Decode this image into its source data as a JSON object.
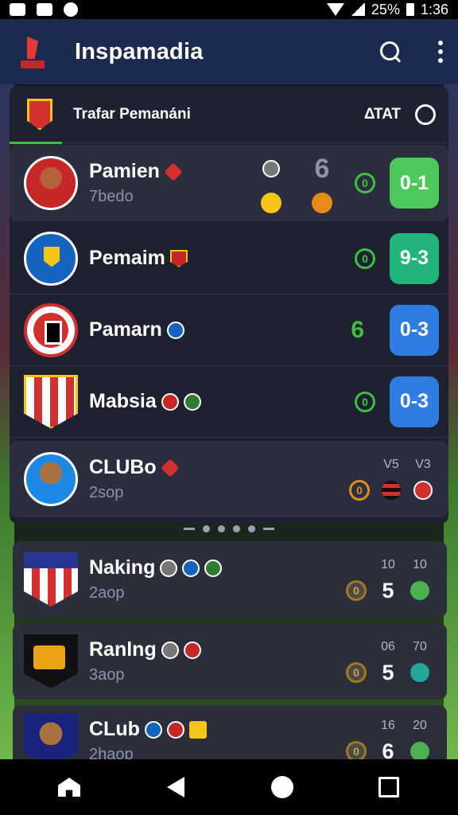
{
  "status_bar": {
    "battery": "25%",
    "time": "1:36"
  },
  "app_bar": {
    "title": "Inspamadia"
  },
  "filter": {
    "label": "Trafar Pemanáni",
    "date": "ΔΤΑΤ"
  },
  "matches": [
    {
      "team": "Pamien",
      "sub": "7bedo",
      "side_number": "6",
      "mid_value": "0",
      "score": "0-1"
    },
    {
      "team": "Pemaim",
      "mid_value": "0",
      "score": "9-3"
    },
    {
      "team": "Pamarn",
      "mid_value": "6",
      "score": "0-3"
    },
    {
      "team": "Mabsia",
      "mid_value": "0",
      "score": "0-3"
    },
    {
      "team": "CLUBo",
      "sub": "2sop",
      "coin_value": "0",
      "stat_top": [
        "V5",
        "V3"
      ]
    }
  ],
  "cards": [
    {
      "team": "Naking",
      "sub": "2aop",
      "coin_value": "0",
      "stat_top": [
        "10",
        "10"
      ],
      "score": "5"
    },
    {
      "team": "Ranlng",
      "sub": "3aop",
      "coin_value": "0",
      "stat_top": [
        "06",
        "70"
      ],
      "score": "5"
    },
    {
      "team": "CLub",
      "sub": "2haop",
      "coin_value": "0",
      "stat_top": [
        "16",
        "20"
      ],
      "score": "6"
    }
  ],
  "icons": {
    "search": "search-icon",
    "more": "more-vert-icon",
    "home": "home-icon",
    "back": "back-icon",
    "overview": "recents-icon"
  },
  "colors": {
    "app_bar": "#1b2a4e",
    "score_green": "#4cc95a",
    "score_teal": "#22b57a",
    "score_blue": "#2f7de0",
    "accent_green": "#3fbf3f"
  }
}
